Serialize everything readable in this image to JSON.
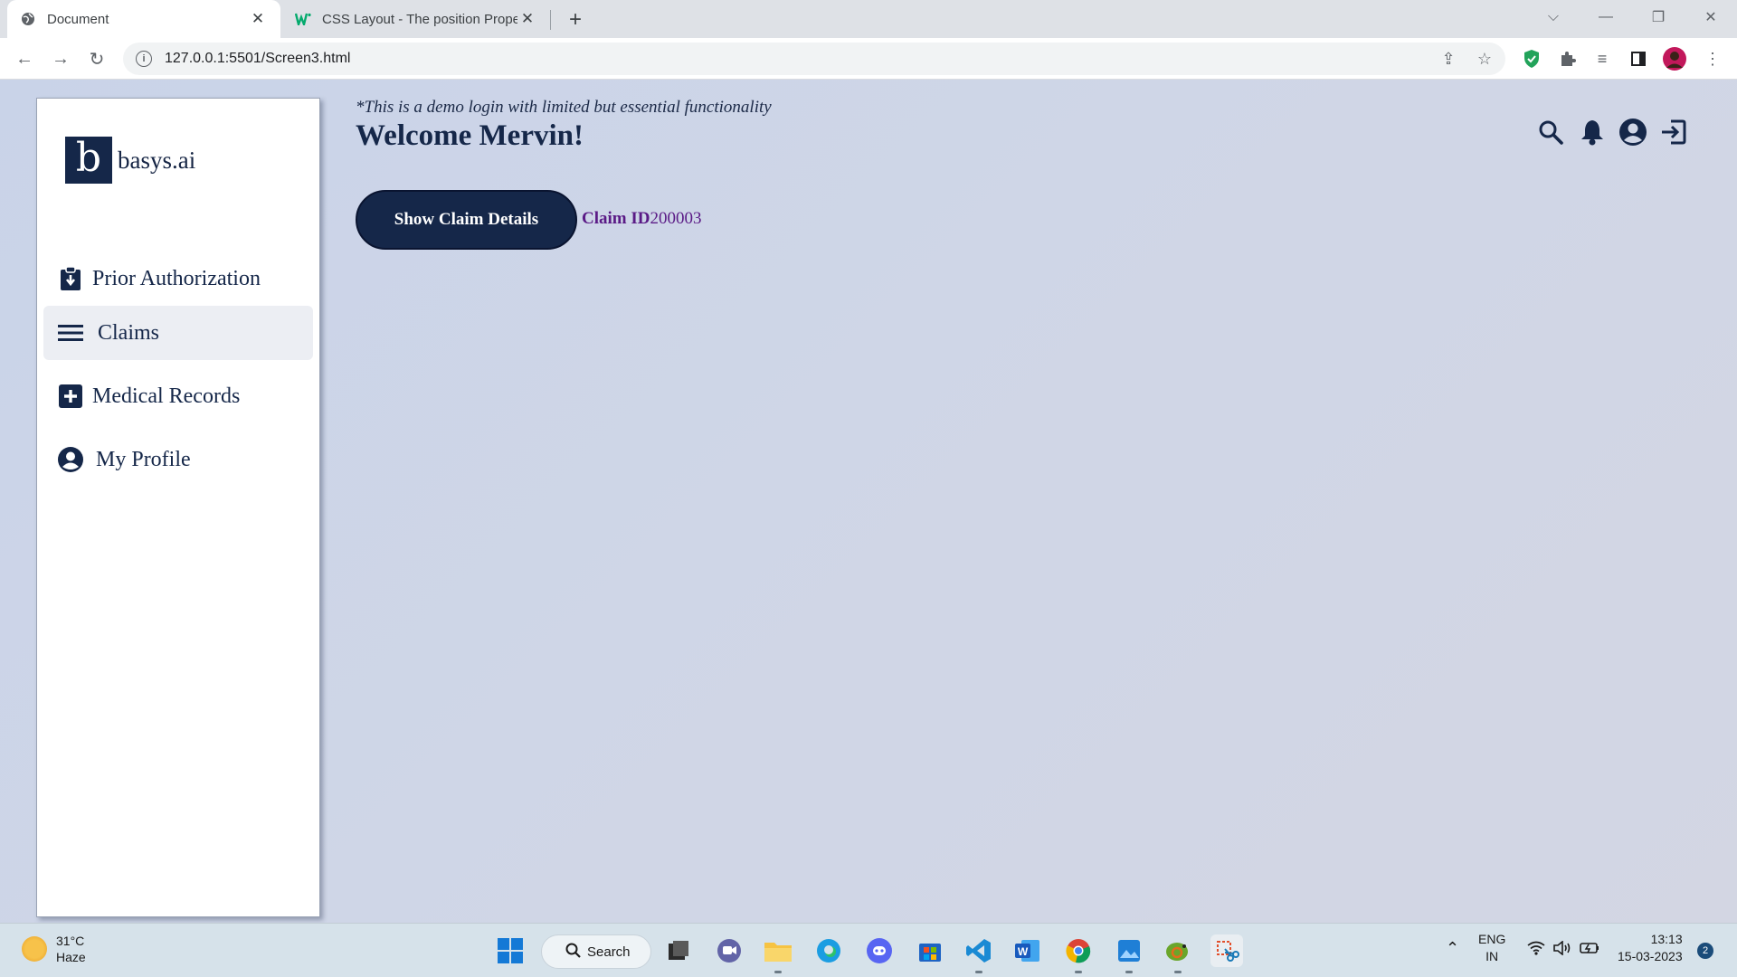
{
  "browser": {
    "tabs": [
      {
        "title": "Document",
        "active": true
      },
      {
        "title": "CSS Layout - The position Proper",
        "active": false
      }
    ],
    "url": "127.0.0.1:5501/Screen3.html"
  },
  "app": {
    "logo_letter": "b",
    "logo_text": "basys.ai",
    "nav": [
      {
        "label": "Prior Authorization",
        "icon": "clipboard-download-icon",
        "active": false
      },
      {
        "label": "Claims",
        "icon": "hamburger-menu-icon",
        "active": true
      },
      {
        "label": "Medical Records",
        "icon": "plus-square-icon",
        "active": false
      },
      {
        "label": "My Profile",
        "icon": "user-circle-icon",
        "active": false
      }
    ],
    "demo_note": "*This is a demo login with limited but essential functionality",
    "welcome": "Welcome Mervin!",
    "claim_button": "Show Claim Details",
    "claim_id_label": "Claim ID",
    "claim_id_value": "200003",
    "header_icons": [
      "search-icon",
      "bell-icon",
      "account-circle-icon",
      "logout-icon"
    ],
    "colors": {
      "navy": "#152749",
      "claim_id": "#5a1a86"
    }
  },
  "taskbar": {
    "weather_temp": "31°C",
    "weather_desc": "Haze",
    "search_label": "Search",
    "lang_top": "ENG",
    "lang_bottom": "IN",
    "time": "13:13",
    "date": "15-03-2023",
    "notification_count": "2"
  }
}
